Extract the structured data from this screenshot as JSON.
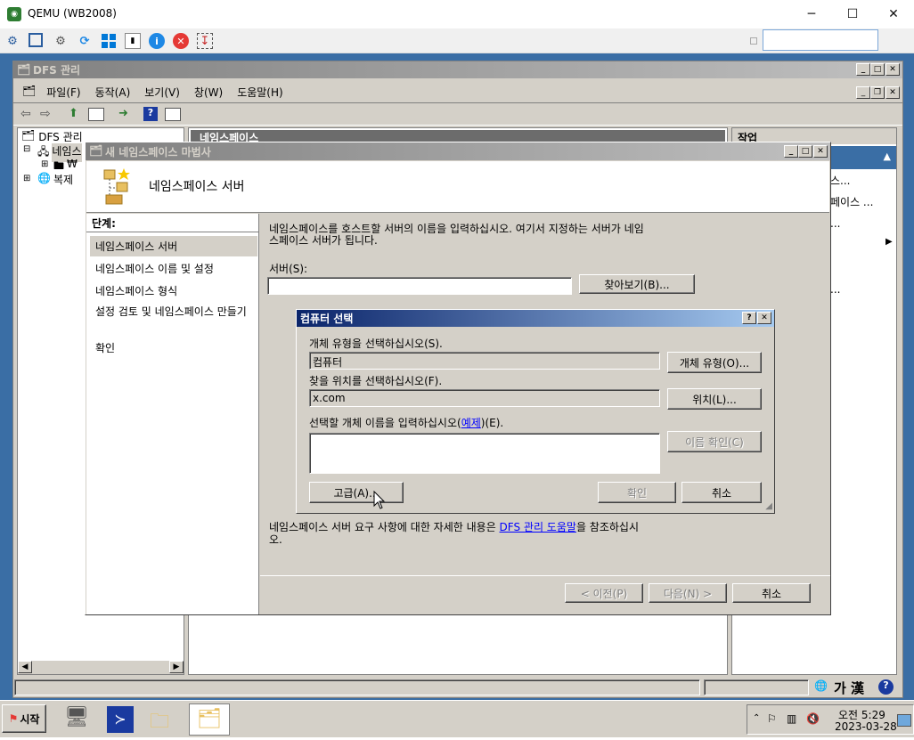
{
  "qemu": {
    "title": "QEMU (WB2008)",
    "window_controls": [
      "─",
      "☐",
      "✕"
    ],
    "toolbar_icons": [
      "network-icon",
      "fullscreen-icon",
      "settings-icon",
      "refresh-icon",
      "windows-icon",
      "usb-icon",
      "info-icon",
      "close-red-icon",
      "screenshot-icon"
    ],
    "search_value": ""
  },
  "mmc": {
    "title": "DFS 관리",
    "menu": [
      "파일(F)",
      "동작(A)",
      "보기(V)",
      "창(W)",
      "도움말(H)"
    ],
    "tree": {
      "root": "DFS 관리",
      "namespace": "네임스",
      "namespace_child": "₩",
      "replication": "복제"
    },
    "center_header": "네임스페이스",
    "actions_header": "작업",
    "actions_items": [
      "스...",
      "페이스 ...",
      "...",
      "..."
    ]
  },
  "wizard": {
    "title": "새 네임스페이스 마법사",
    "header": "네임스페이스 서버",
    "steps_label": "단계:",
    "steps": [
      "네임스페이스 서버",
      "네임스페이스 이름 및 설정",
      "네임스페이스 형식",
      "설정 검토 및 네임스페이스 만들기",
      "확인"
    ],
    "intro_line1": "네임스페이스를 호스트할 서버의 이름을 입력하십시오. 여기서 지정하는 서버가 네임",
    "intro_line2": "스페이스 서버가 됩니다.",
    "server_label": "서버(S):",
    "server_value": "",
    "browse_button": "찾아보기(B)...",
    "help_line1_before": "네임스페이스 서버 요구 사항에 대한 자세한 내용은 ",
    "help_link": "DFS 관리 도움말",
    "help_line1_after": "을 참조하십시",
    "help_line2": "오.",
    "prev_button": "< 이전(P)",
    "next_button": "다음(N) >",
    "cancel_button": "취소"
  },
  "select_computer": {
    "title": "컴퓨터 선택",
    "object_type_label": "개체 유형을 선택하십시오(S).",
    "object_type_value": "컴퓨터",
    "object_type_button": "개체 유형(O)...",
    "location_label": "찾을 위치를 선택하십시오(F).",
    "location_value": "x.com",
    "location_button": "위치(L)...",
    "names_label_before": "선택할 개체 이름을 입력하십시오(",
    "names_label_link": "예제",
    "names_label_after": ")(E).",
    "names_value": "",
    "check_names_button": "이름 확인(C)",
    "advanced_button": "고급(A)...",
    "ok_button": "확인",
    "cancel_button": "취소"
  },
  "statusbar": {
    "ime": "가 漢"
  },
  "taskbar": {
    "start": "시작",
    "time": "오전 5:29",
    "date": "2023-03-28"
  }
}
